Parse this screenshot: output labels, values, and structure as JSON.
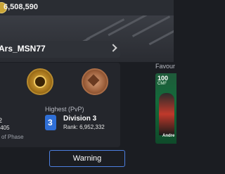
{
  "top": {
    "coins": "6,508,590"
  },
  "profile": {
    "name": "Ars_MSN77"
  },
  "stats": {
    "left_line1": "2",
    "left_line2": ",405",
    "left_line3": "l of Phase"
  },
  "highest": {
    "label": "Highest (PvP)",
    "division_number": "3",
    "division": "Division 3",
    "rank": "Rank: 6,952,332"
  },
  "favourite": {
    "label": "Favour",
    "card_rating": "100",
    "card_pos": "CMF",
    "card_name": "Andre"
  },
  "warning": {
    "label": "Warning"
  }
}
